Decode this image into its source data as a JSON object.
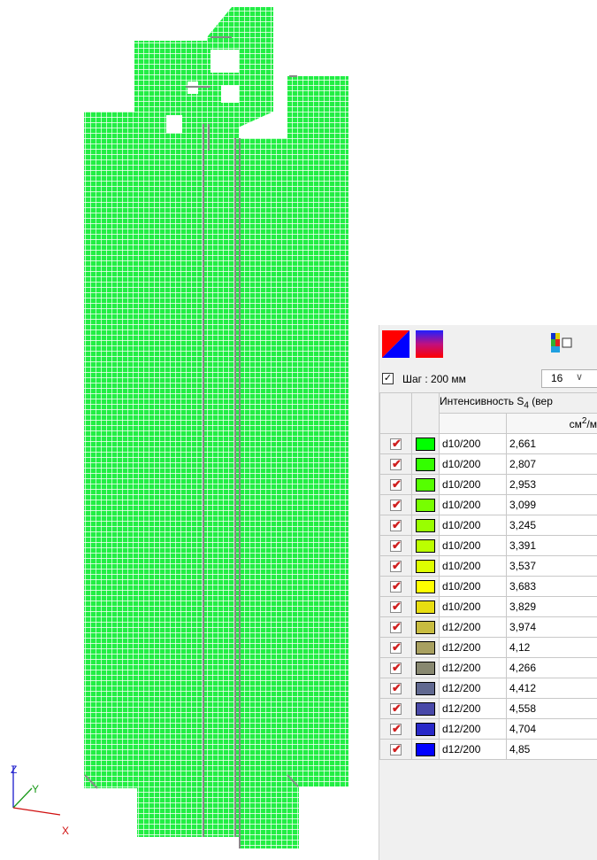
{
  "legend": {
    "step_label": "Шаг : 200 мм",
    "step_checked": true,
    "step_select_value": "16",
    "header_title_main": "Интенсивность S",
    "header_title_sub": "4",
    "header_title_rest": " (вер",
    "header_unit_main": "см",
    "header_unit_sup": "2",
    "header_unit_rest": "/м",
    "rows": [
      {
        "bar": "d10/200",
        "value": "2,661",
        "color": "#00ff00"
      },
      {
        "bar": "d10/200",
        "value": "2,807",
        "color": "#33ff00"
      },
      {
        "bar": "d10/200",
        "value": "2,953",
        "color": "#55ff00"
      },
      {
        "bar": "d10/200",
        "value": "3,099",
        "color": "#77ff00"
      },
      {
        "bar": "d10/200",
        "value": "3,245",
        "color": "#99ff00"
      },
      {
        "bar": "d10/200",
        "value": "3,391",
        "color": "#bbff00"
      },
      {
        "bar": "d10/200",
        "value": "3,537",
        "color": "#ddff00"
      },
      {
        "bar": "d10/200",
        "value": "3,683",
        "color": "#ffff00"
      },
      {
        "bar": "d10/200",
        "value": "3,829",
        "color": "#e8dd10"
      },
      {
        "bar": "d12/200",
        "value": "3,974",
        "color": "#c8bc40"
      },
      {
        "bar": "d12/200",
        "value": "4,12",
        "color": "#a8a060"
      },
      {
        "bar": "d12/200",
        "value": "4,266",
        "color": "#888870"
      },
      {
        "bar": "d12/200",
        "value": "4,412",
        "color": "#606890"
      },
      {
        "bar": "d12/200",
        "value": "4,558",
        "color": "#4848a8"
      },
      {
        "bar": "d12/200",
        "value": "4,704",
        "color": "#2828c8"
      },
      {
        "bar": "d12/200",
        "value": "4,85",
        "color": "#0000ff"
      }
    ]
  },
  "axes": {
    "z_label": "Z",
    "y_label": "Y",
    "x_label": "X"
  },
  "colors": {
    "mesh_fill": "#22ee44",
    "mesh_line": "#ffffff",
    "slab_edge": "#888888"
  },
  "icons": {
    "mode_button_1": "red-blue-diagonal-icon",
    "mode_button_2": "gradient-icon",
    "grid_toggle": "color-scale-toggle-icon"
  }
}
